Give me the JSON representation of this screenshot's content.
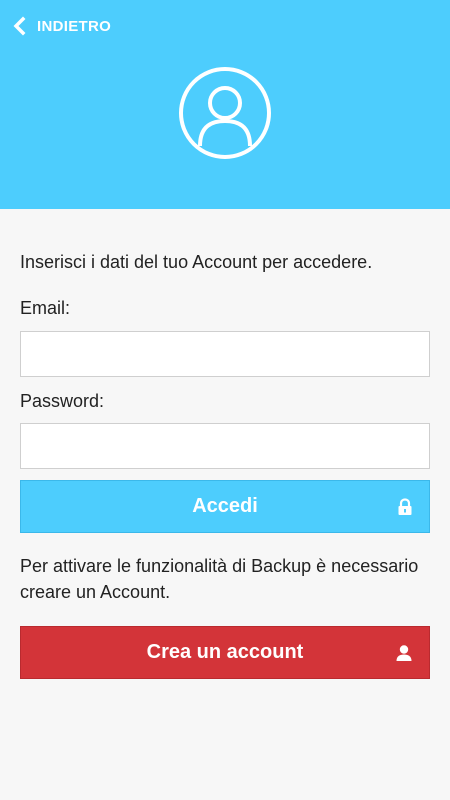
{
  "header": {
    "back_label": "INDIETRO",
    "background_color": "#4dcdfd",
    "avatar_icon": "user-circle-icon"
  },
  "form": {
    "intro_text": "Inserisci i dati del tuo Account per accedere.",
    "email_label": "Email:",
    "email_value": "",
    "password_label": "Password:",
    "password_value": "",
    "login_button_label": "Accedi",
    "login_button_icon": "lock-icon",
    "login_button_color": "#4dcdfd"
  },
  "signup": {
    "info_text": "Per attivare le funzionalità di Backup è necessario creare un Account.",
    "create_button_label": "Crea un account",
    "create_button_icon": "user-icon",
    "create_button_color": "#d33439"
  }
}
